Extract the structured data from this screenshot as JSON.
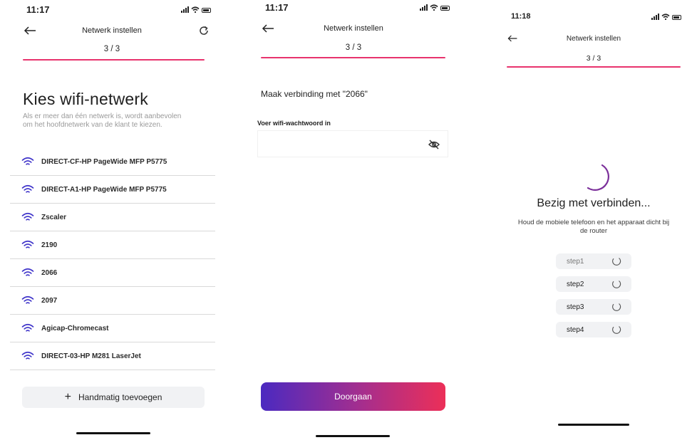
{
  "screen1": {
    "status_time": "11:17",
    "header_title": "Netwerk instellen",
    "step": "3 / 3",
    "heading": "Kies wifi-netwerk",
    "subtitle_lines": [
      "Als er meer dan één netwerk is, wordt aanbevolen",
      "om het hoofdnetwerk van de klant te kiezen."
    ],
    "networks": [
      "DIRECT-CF-HP PageWide MFP P5775",
      "DIRECT-A1-HP PageWide MFP P5775",
      "Zscaler",
      "2190",
      "2066",
      "2097",
      "Agicap-Chromecast",
      "DIRECT-03-HP M281 LaserJet"
    ],
    "add_button_label": "Handmatig toevoegen",
    "add_button_icon": "+"
  },
  "screen2": {
    "status_time": "11:17",
    "header_title": "Netwerk instellen",
    "step": "3 / 3",
    "connect_label": "Maak verbinding met \"2066\"",
    "password_label": "Voer wifi-wachtwoord in",
    "password_value": "",
    "continue_label": "Doorgaan"
  },
  "screen3": {
    "status_time": "11:18",
    "header_title": "Netwerk instellen",
    "step": "3 / 3",
    "connecting_title": "Bezig met verbinden...",
    "connecting_sub_lines": [
      "Houd de mobiele telefoon en het apparaat dicht bij",
      "de router"
    ],
    "steps": [
      "step1",
      "step2",
      "step3",
      "step4"
    ]
  },
  "colors": {
    "accent": "#e8336d",
    "wifi_icon": "#3e33c9",
    "gradient_start": "#4b2ac0",
    "gradient_end": "#ec2f58"
  }
}
